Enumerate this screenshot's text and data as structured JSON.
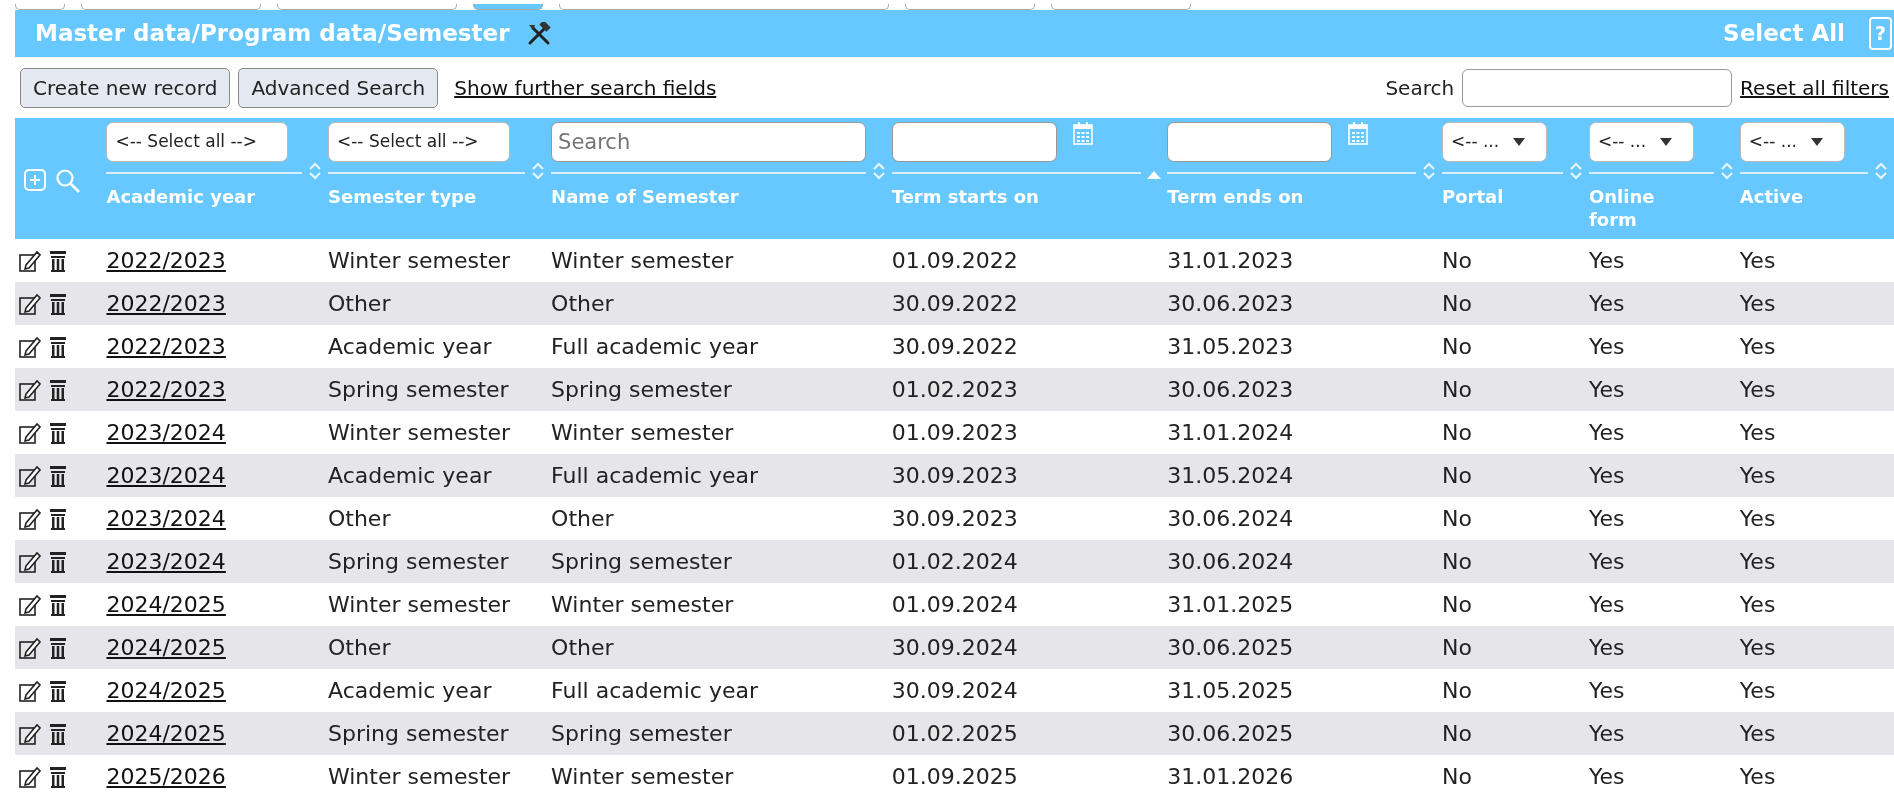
{
  "header": {
    "title": "Master data/Program data/Semester",
    "select_all": "Select All",
    "help": "?"
  },
  "toolbar": {
    "buttons": [
      "Create new record",
      "Advanced Search"
    ],
    "link": "Show further search fields",
    "search_label": "Search",
    "reset": "Reset all filters"
  },
  "table": {
    "columns": [
      {
        "label": "Academic year",
        "filter": {
          "kind": "select",
          "value": "<-- Select all -->"
        },
        "sorted": false
      },
      {
        "label": "Semester type",
        "filter": {
          "kind": "select",
          "value": "<-- Select all -->"
        },
        "sorted": false
      },
      {
        "label": "Name of Semester",
        "filter": {
          "kind": "text",
          "placeholder": "Search"
        },
        "sorted": false
      },
      {
        "label": "Term starts on",
        "filter": {
          "kind": "date"
        },
        "sorted": true
      },
      {
        "label": "Term ends on",
        "filter": {
          "kind": "date"
        },
        "sorted": false
      },
      {
        "label": "Portal",
        "filter": {
          "kind": "dropdown",
          "value": "<-- ..."
        },
        "sorted": false
      },
      {
        "label": "Online form",
        "filter": {
          "kind": "dropdown",
          "value": "<-- ..."
        },
        "sorted": false
      },
      {
        "label": "Active",
        "filter": {
          "kind": "dropdown",
          "value": "<-- ..."
        },
        "sorted": false
      }
    ],
    "rows": [
      [
        "2022/2023",
        "Winter semester",
        "Winter semester",
        "01.09.2022",
        "31.01.2023",
        "No",
        "Yes",
        "Yes"
      ],
      [
        "2022/2023",
        "Other",
        "Other",
        "30.09.2022",
        "30.06.2023",
        "No",
        "Yes",
        "Yes"
      ],
      [
        "2022/2023",
        "Academic year",
        "Full academic year",
        "30.09.2022",
        "31.05.2023",
        "No",
        "Yes",
        "Yes"
      ],
      [
        "2022/2023",
        "Spring semester",
        "Spring semester",
        "01.02.2023",
        "30.06.2023",
        "No",
        "Yes",
        "Yes"
      ],
      [
        "2023/2024",
        "Winter semester",
        "Winter semester",
        "01.09.2023",
        "31.01.2024",
        "No",
        "Yes",
        "Yes"
      ],
      [
        "2023/2024",
        "Academic year",
        "Full academic year",
        "30.09.2023",
        "31.05.2024",
        "No",
        "Yes",
        "Yes"
      ],
      [
        "2023/2024",
        "Other",
        "Other",
        "30.09.2023",
        "30.06.2024",
        "No",
        "Yes",
        "Yes"
      ],
      [
        "2023/2024",
        "Spring semester",
        "Spring semester",
        "01.02.2024",
        "30.06.2024",
        "No",
        "Yes",
        "Yes"
      ],
      [
        "2024/2025",
        "Winter semester",
        "Winter semester",
        "01.09.2024",
        "31.01.2025",
        "No",
        "Yes",
        "Yes"
      ],
      [
        "2024/2025",
        "Other",
        "Other",
        "30.09.2024",
        "30.06.2025",
        "No",
        "Yes",
        "Yes"
      ],
      [
        "2024/2025",
        "Academic year",
        "Full academic year",
        "30.09.2024",
        "31.05.2025",
        "No",
        "Yes",
        "Yes"
      ],
      [
        "2024/2025",
        "Spring semester",
        "Spring semester",
        "01.02.2025",
        "30.06.2025",
        "No",
        "Yes",
        "Yes"
      ],
      [
        "2025/2026",
        "Winter semester",
        "Winter semester",
        "01.09.2025",
        "31.01.2026",
        "No",
        "Yes",
        "Yes"
      ]
    ]
  }
}
